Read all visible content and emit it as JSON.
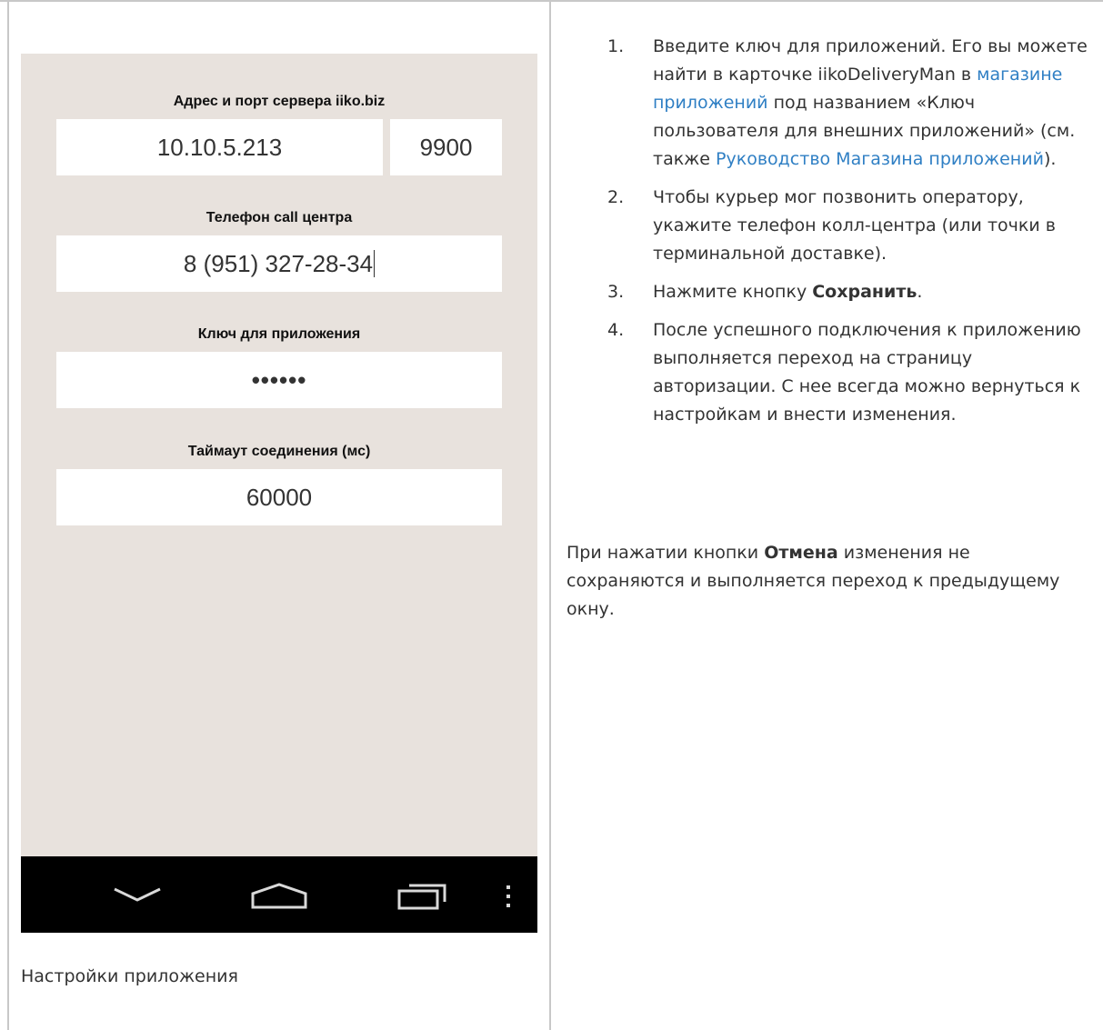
{
  "phone": {
    "server_label": "Адрес и порт сервера iiko.biz",
    "server_address": "10.10.5.213",
    "server_port": "9900",
    "phone_label": "Телефон call центра",
    "phone_value": "8 (951) 327-28-34",
    "key_label": "Ключ для приложения",
    "key_value": "••••••",
    "timeout_label": "Таймаут соединения (мс)",
    "timeout_value": "60000",
    "nav_icons": [
      "chevron-down-icon",
      "home-icon",
      "recent-apps-icon",
      "more-vert-icon"
    ]
  },
  "caption": "Настройки приложения",
  "steps": [
    {
      "num": "1.",
      "parts": [
        "Введите ключ для приложений. Его вы можете найти в карточке iikoDeliveryMan в ",
        "магазине приложений",
        " под названием «Ключ пользователя для внешних приложений» (см. также ",
        "Руководство Магазина приложений",
        ")."
      ]
    },
    {
      "num": "2.",
      "text": "Чтобы курьер мог позвонить оператору, укажите телефон колл-центра (или точки в терминальной доставке)."
    },
    {
      "num": "3.",
      "before": " Нажмите кнопку ",
      "bold": "Сохранить",
      "after": "."
    },
    {
      "num": "4.",
      "text": "После успешного подключения к приложению выполняется переход на страницу авторизации. С нее всегда можно вернуться к настройкам и внести изменения."
    }
  ],
  "paragraph": {
    "before": "При нажатии кнопки ",
    "bold": "Отмена",
    "after": " изменения не сохраняются и выполняется переход к предыдущему окну."
  },
  "colors": {
    "link": "#2f7fc4",
    "phone_bg": "#e8e2dd",
    "navbar": "#000000"
  }
}
